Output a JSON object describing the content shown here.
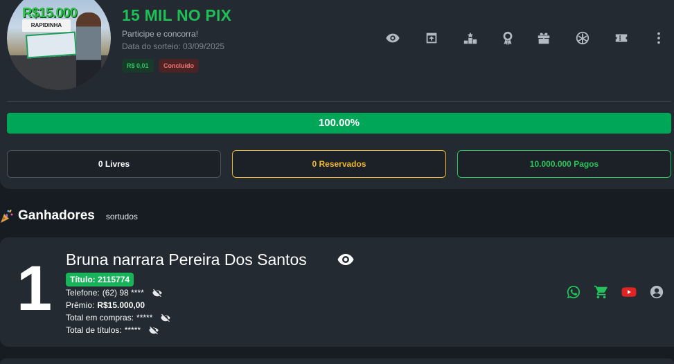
{
  "raffle": {
    "image_text": {
      "headline": "R$15.000",
      "ribbon": "RAPIDINHA"
    },
    "title": "15 MIL NO PIX",
    "subtitle": "Participe e concorra!",
    "draw_date": "Data do sorteio: 03/09/2025",
    "price_badge": "R$ 0,01",
    "status_badge": "Concluído"
  },
  "toolbar": {
    "icons": [
      "eye-icon",
      "share-icon",
      "podium-icon",
      "award-icon",
      "gift-icon",
      "wheel-icon",
      "ticket-icon",
      "more-icon"
    ]
  },
  "progress": {
    "value": 1.0,
    "label": "100.00%"
  },
  "stats": {
    "free": "0 Livres",
    "reserved": "0 Reservados",
    "paid": "10.000.000 Pagos"
  },
  "winners": {
    "title": "Ganhadores",
    "subtitle": "sortudos",
    "items": [
      {
        "rank": "1",
        "name": "Bruna narrara Pereira Dos Santos",
        "ticket": "Título: 2115774",
        "phone_label": "Telefone:",
        "phone_value": "(62) 98 ****",
        "prize_label": "Prêmio:",
        "prize_value": "R$15.000,00",
        "total_purchases_label": "Total em compras:",
        "total_purchases_value": "*****",
        "total_tickets_label": "Total de títulos:",
        "total_tickets_value": "*****"
      }
    ]
  },
  "colors": {
    "accent_green": "#1fbf56",
    "progress_green": "#00a657",
    "reserved_yellow": "#f1b828",
    "status_red": "#f07474",
    "whatsapp": "#25c15a",
    "youtube": "#e02424",
    "card_bg": "#232a32",
    "page_bg": "#171c22"
  }
}
